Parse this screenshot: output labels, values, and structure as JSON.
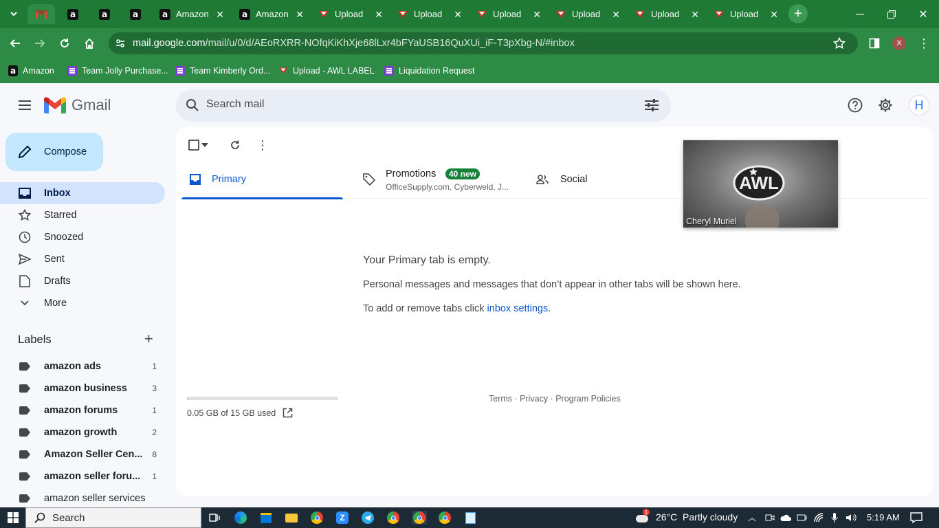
{
  "browser": {
    "tabs": [
      {
        "label": "",
        "type": "gmail",
        "active": true
      },
      {
        "label": "",
        "type": "amazon"
      },
      {
        "label": "",
        "type": "amazon"
      },
      {
        "label": "",
        "type": "amazon"
      },
      {
        "label": "Amazon",
        "type": "amazon"
      },
      {
        "label": "Amazon",
        "type": "amazon"
      },
      {
        "label": "Upload",
        "type": "upload"
      },
      {
        "label": "Upload",
        "type": "upload"
      },
      {
        "label": "Upload",
        "type": "upload"
      },
      {
        "label": "Upload",
        "type": "upload"
      },
      {
        "label": "Upload",
        "type": "upload"
      },
      {
        "label": "Upload",
        "type": "upload"
      }
    ],
    "url_host": "mail.google.com",
    "url_path": "/mail/u/0/d/AEoRXRR-NOfqKiKhXje68lLxr4bFYaUSB16QuXUi_iF-T3pXbg-N/#inbox",
    "profile_initial": "X",
    "bookmarks": [
      {
        "label": "Amazon",
        "icon": "amazon-icon"
      },
      {
        "label": "Team Jolly Purchase...",
        "icon": "list-icon"
      },
      {
        "label": "Team Kimberly Ord...",
        "icon": "list-icon"
      },
      {
        "label": "Upload - AWL LABEL",
        "icon": "upload-icon"
      },
      {
        "label": "Liquidation Request",
        "icon": "list-icon"
      }
    ]
  },
  "gmail": {
    "brand": "Gmail",
    "search_placeholder": "Search mail",
    "avatar_initial": "H",
    "compose_label": "Compose",
    "nav": [
      {
        "label": "Inbox",
        "icon": "inbox-icon",
        "active": true
      },
      {
        "label": "Starred",
        "icon": "star-icon"
      },
      {
        "label": "Snoozed",
        "icon": "clock-icon"
      },
      {
        "label": "Sent",
        "icon": "send-icon"
      },
      {
        "label": "Drafts",
        "icon": "draft-icon"
      },
      {
        "label": "More",
        "icon": "chevron-down-icon"
      }
    ],
    "labels_heading": "Labels",
    "labels": [
      {
        "label": "amazon ads",
        "count": "1",
        "bold": true
      },
      {
        "label": "amazon business",
        "count": "3",
        "bold": true
      },
      {
        "label": "amazon forums",
        "count": "1",
        "bold": true
      },
      {
        "label": "amazon growth",
        "count": "2",
        "bold": true
      },
      {
        "label": "Amazon Seller Cen...",
        "count": "8",
        "bold": true
      },
      {
        "label": "amazon seller foru...",
        "count": "1",
        "bold": true
      },
      {
        "label": "amazon seller services",
        "count": "",
        "bold": false
      }
    ],
    "tabs": {
      "primary": "Primary",
      "promotions": "Promotions",
      "promotions_badge": "40 new",
      "promotions_sub": "OfficeSupply.com, Cyberweld, J...",
      "social": "Social"
    },
    "empty": {
      "title": "Your Primary tab is empty.",
      "line1": "Personal messages and messages that don’t appear in other tabs will be shown here.",
      "line2_prefix": "To add or remove tabs click ",
      "line2_link": "inbox settings",
      "line2_suffix": "."
    },
    "storage": {
      "text": "0.05 GB of 15 GB used",
      "fraction": 0.0033
    },
    "footer": "Terms · Privacy · Program Policies",
    "video_tile": {
      "name": "Cheryl Muriel",
      "logo_text": "AWL"
    }
  },
  "taskbar": {
    "search_placeholder": "Search",
    "weather": "26°C  Partly cloudy",
    "weather_badge": "1",
    "time": "5:19 AM"
  },
  "colors": {
    "chrome_green": "#2e8b45",
    "accent_blue": "#0b57d0",
    "badge_green": "#188038"
  }
}
